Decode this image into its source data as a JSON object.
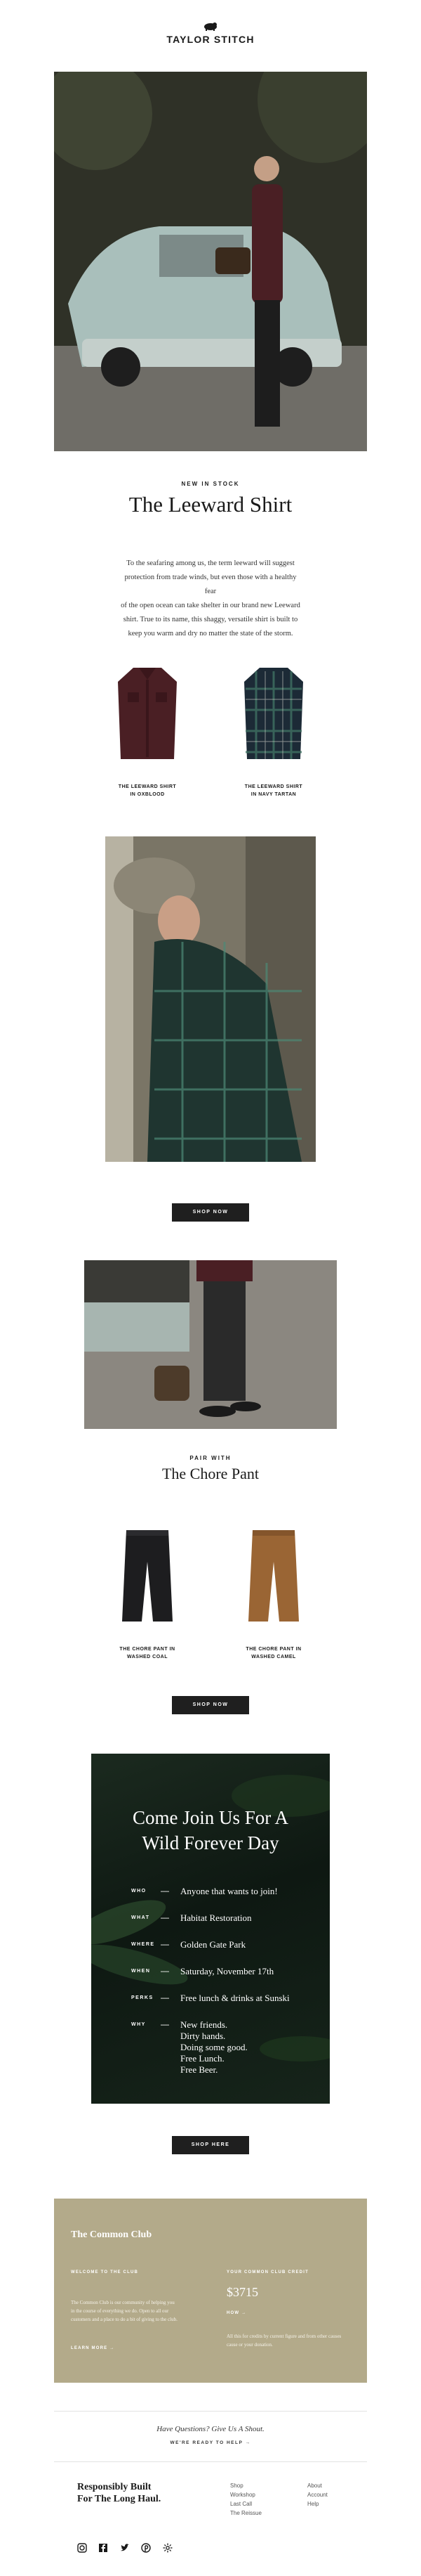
{
  "brand": {
    "name": "TAYLOR STITCH",
    "logo_icon": "bear-icon"
  },
  "hero": {
    "alt": "Man in maroon shirt leaning on vintage car"
  },
  "shirt_section": {
    "eyebrow": "NEW IN STOCK",
    "title": "The Leeward Shirt",
    "body_lines": [
      "To the seafaring among us, the term leeward will suggest",
      "protection from trade winds, but even those with a healthy fear",
      "of the open ocean can take shelter in our brand new Leeward",
      "shirt. True to its name, this shaggy, versatile shirt is built to",
      "keep you warm and dry no matter the state of the storm."
    ],
    "products": [
      {
        "line1": "THE LEEWARD SHIRT",
        "line2": "IN OXBLOOD",
        "color": "#4a1f24"
      },
      {
        "line1": "THE LEEWARD SHIRT",
        "line2": "IN NAVY TARTAN",
        "color": "#1c2a36"
      }
    ],
    "cta": "SHOP NOW"
  },
  "pant_section": {
    "eyebrow": "PAIR WITH",
    "title": "The Chore Pant",
    "products": [
      {
        "line1": "THE CHORE PANT IN",
        "line2": "WASHED COAL",
        "color": "#1d1d1f"
      },
      {
        "line1": "THE CHORE PANT IN",
        "line2": "WASHED CAMEL",
        "color": "#9a6534"
      }
    ],
    "cta": "SHOP NOW"
  },
  "event": {
    "title_line1": "Come Join Us For A",
    "title_line2": "Wild Forever Day",
    "rows": [
      {
        "key": "WHO",
        "value": "Anyone that wants to join!"
      },
      {
        "key": "WHAT",
        "value": "Habitat Restoration"
      },
      {
        "key": "WHERE",
        "value": "Golden Gate Park"
      },
      {
        "key": "WHEN",
        "value": "Saturday, November 17th"
      },
      {
        "key": "PERKS",
        "value": "Free lunch & drinks at Sunski"
      },
      {
        "key": "WHY",
        "lines": [
          "New friends.",
          "Dirty hands.",
          "Doing some good.",
          "Free Lunch.",
          "Free Beer."
        ]
      }
    ],
    "cta": "SHOP HERE"
  },
  "club": {
    "title": "The Common Club",
    "welcome_label": "WELCOME TO THE CLUB",
    "welcome_lines": [
      "The Common Club is our community of helping you",
      "in the course of everything we do. Open to all our",
      "customers and a place to do a bit of giving to the club."
    ],
    "learn_more": "LEARN MORE →",
    "credit_label": "YOUR COMMON CLUB CREDIT",
    "credit_value": "$3715",
    "how_label": "HOW →",
    "how_lines": [
      "All this for credits by current figure and from other causes",
      "cause or your donation."
    ]
  },
  "footer": {
    "question": "Have Questions? Give Us A Shout.",
    "help": "WE'RE READY TO HELP →",
    "tagline_line1": "Responsibly Built",
    "tagline_line2": "For The Long Haul.",
    "links_col1": [
      "Shop",
      "Workshop",
      "Last Call",
      "The Reissue"
    ],
    "links_col2": [
      "About",
      "Account",
      "Help"
    ],
    "social_icons": [
      "instagram-icon",
      "facebook-icon",
      "twitter-icon",
      "pinterest-icon",
      "settings-icon"
    ]
  }
}
